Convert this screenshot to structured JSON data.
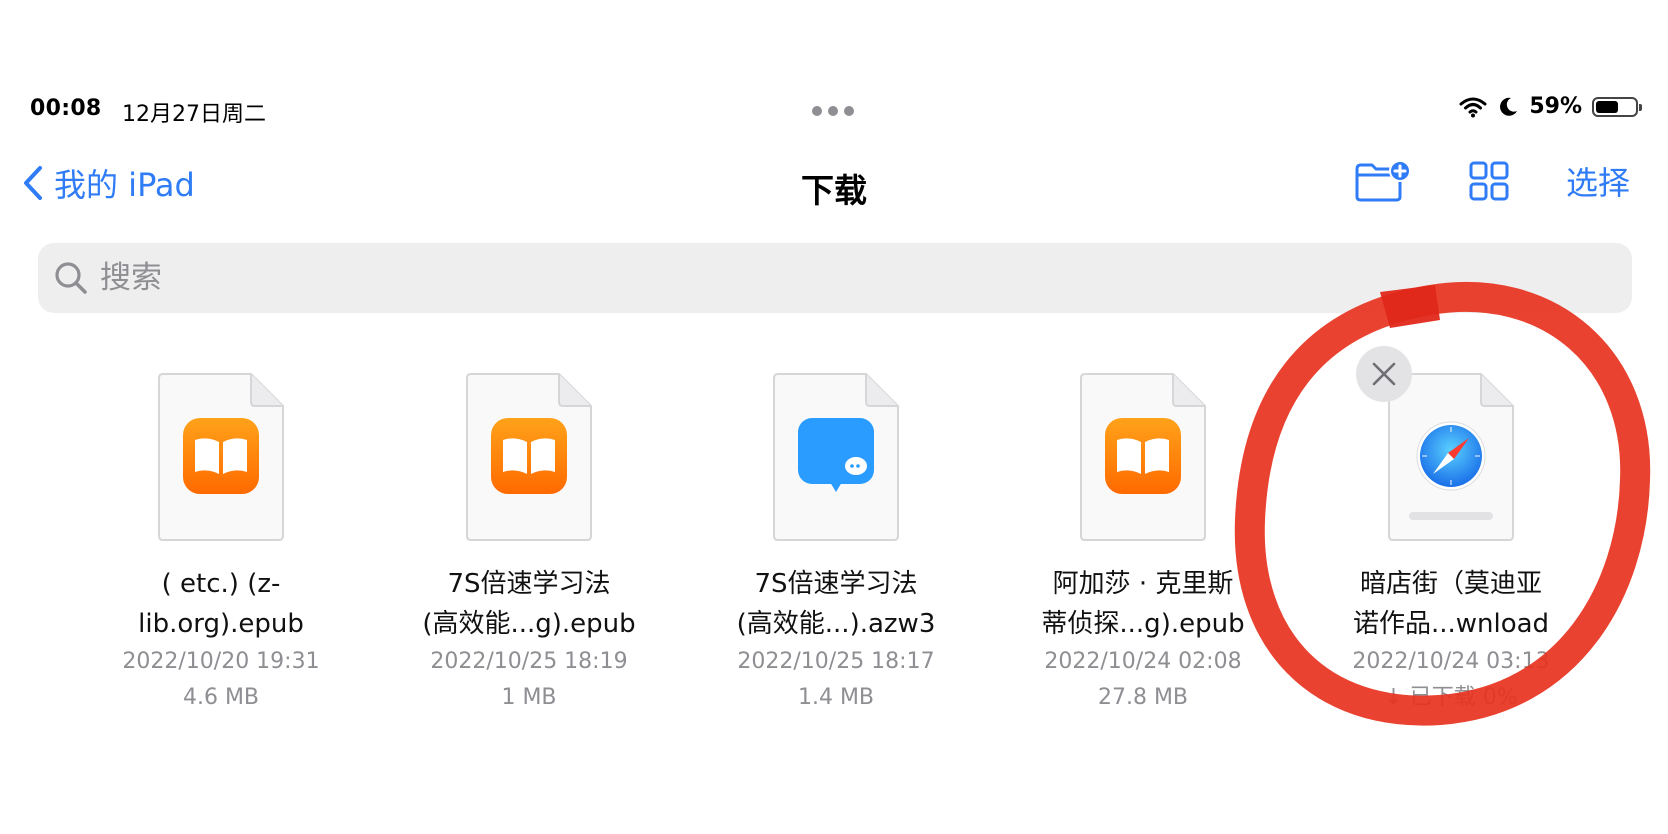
{
  "status_bar": {
    "time": "00:08",
    "date": "12月27日周二",
    "battery_text": "59%",
    "battery_level": 0.59
  },
  "nav": {
    "back_label": "我的 iPad",
    "title": "下载",
    "select_label": "选择"
  },
  "search": {
    "placeholder": "搜索"
  },
  "files": [
    {
      "name_line1": "( etc.) (z-",
      "name_line2": "lib.org).epub",
      "date": "2022/10/20 19:31",
      "size": "4.6 MB",
      "icon": "books-icon"
    },
    {
      "name_line1": "7S倍速学习法",
      "name_line2": "(高效能...g).epub",
      "date": "2022/10/25 18:19",
      "size": "1 MB",
      "icon": "books-icon"
    },
    {
      "name_line1": "7S倍速学习法",
      "name_line2": "(高效能...).azw3",
      "date": "2022/10/25 18:17",
      "size": "1.4 MB",
      "icon": "chat-app-icon"
    },
    {
      "name_line1": "阿加莎 · 克里斯",
      "name_line2": "蒂侦探...g).epub",
      "date": "2022/10/24 02:08",
      "size": "27.8 MB",
      "icon": "books-icon"
    },
    {
      "name_line1": "暗店街（莫迪亚",
      "name_line2": "诺作品...wnload",
      "date": "2022/10/24 03:13",
      "size": "↓ 已下载 0%",
      "icon": "safari-icon",
      "download_progress": 0
    }
  ],
  "colors": {
    "accent": "#2f7cf6",
    "annotation_red": "#e8321e",
    "books_orange": "#ff8a00",
    "chat_blue": "#2a9bff"
  }
}
